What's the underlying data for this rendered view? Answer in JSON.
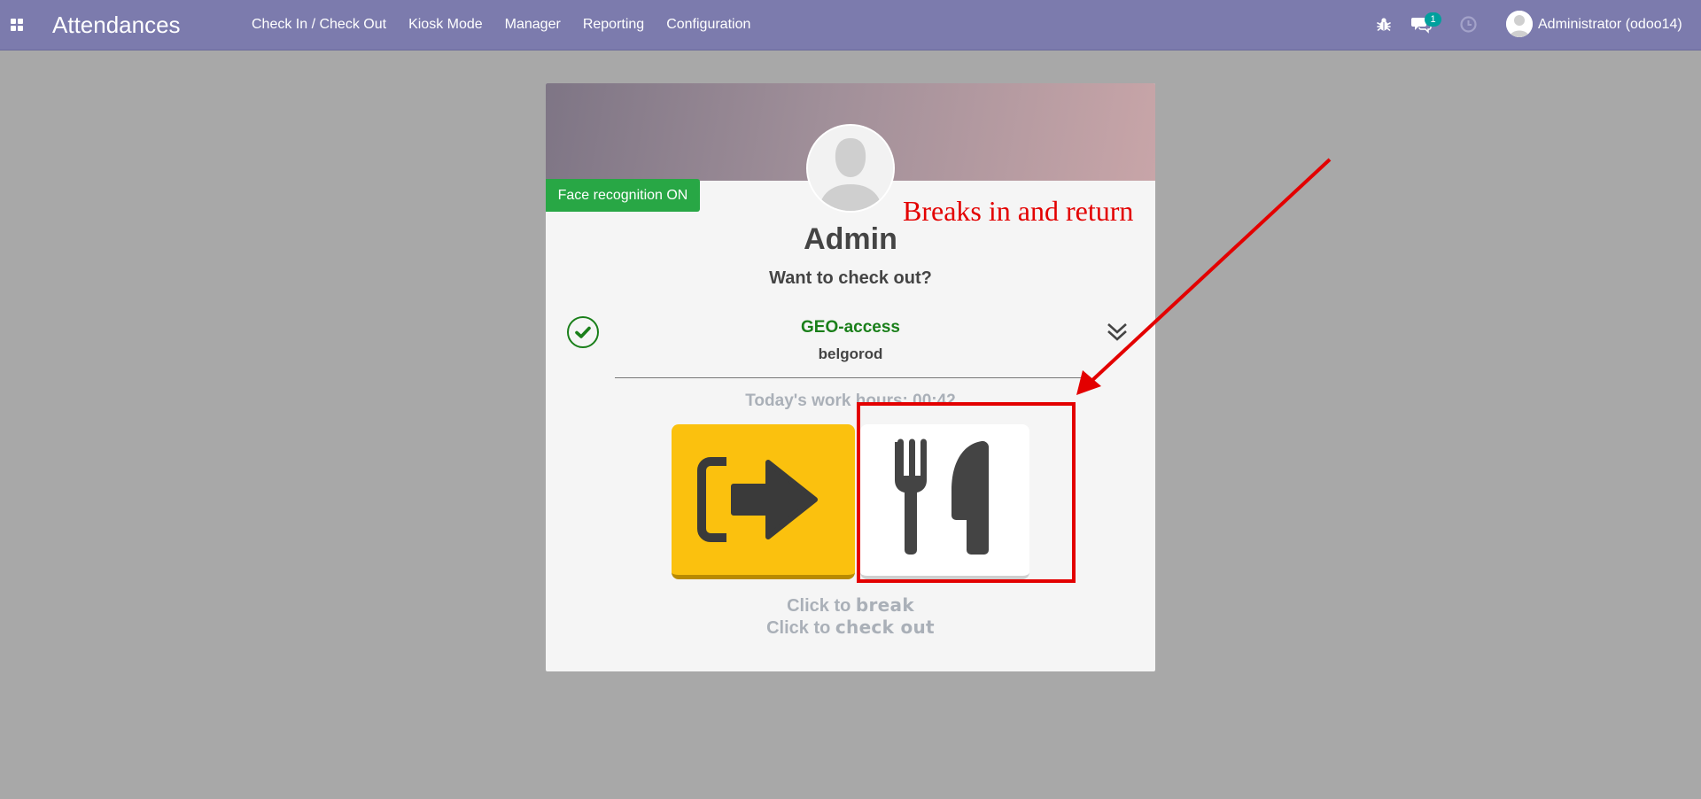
{
  "navbar": {
    "app_icon": "apps-grid-icon",
    "title": "Attendances",
    "menu": [
      {
        "label": "Check In / Check Out"
      },
      {
        "label": "Kiosk Mode"
      },
      {
        "label": "Manager"
      },
      {
        "label": "Reporting"
      },
      {
        "label": "Configuration"
      }
    ],
    "icons": [
      "bug-icon",
      "chat-icon",
      "clock-icon"
    ],
    "chat_badge": "1",
    "user_name": "Administrator (odoo14)"
  },
  "card": {
    "face_badge": "Face recognition ON",
    "employee_name": "Admin",
    "question": "Want to check out?",
    "geo": {
      "title": "GEO-access",
      "place": "belgorod"
    },
    "work_hours": "Today's work hours: 00:42",
    "hint_break_prefix": "Click to ",
    "hint_break_bold": "break",
    "hint_checkout_prefix": "Click to ",
    "hint_checkout_bold": "check out"
  },
  "annotation": {
    "text": "Breaks in and return",
    "color": "#e30000"
  },
  "colors": {
    "navbar": "#7c7bad",
    "background": "#a8a8a8",
    "checkout_button": "#fbc10e",
    "face_badge": "#28a745",
    "geo_title": "#1a7f1a"
  }
}
